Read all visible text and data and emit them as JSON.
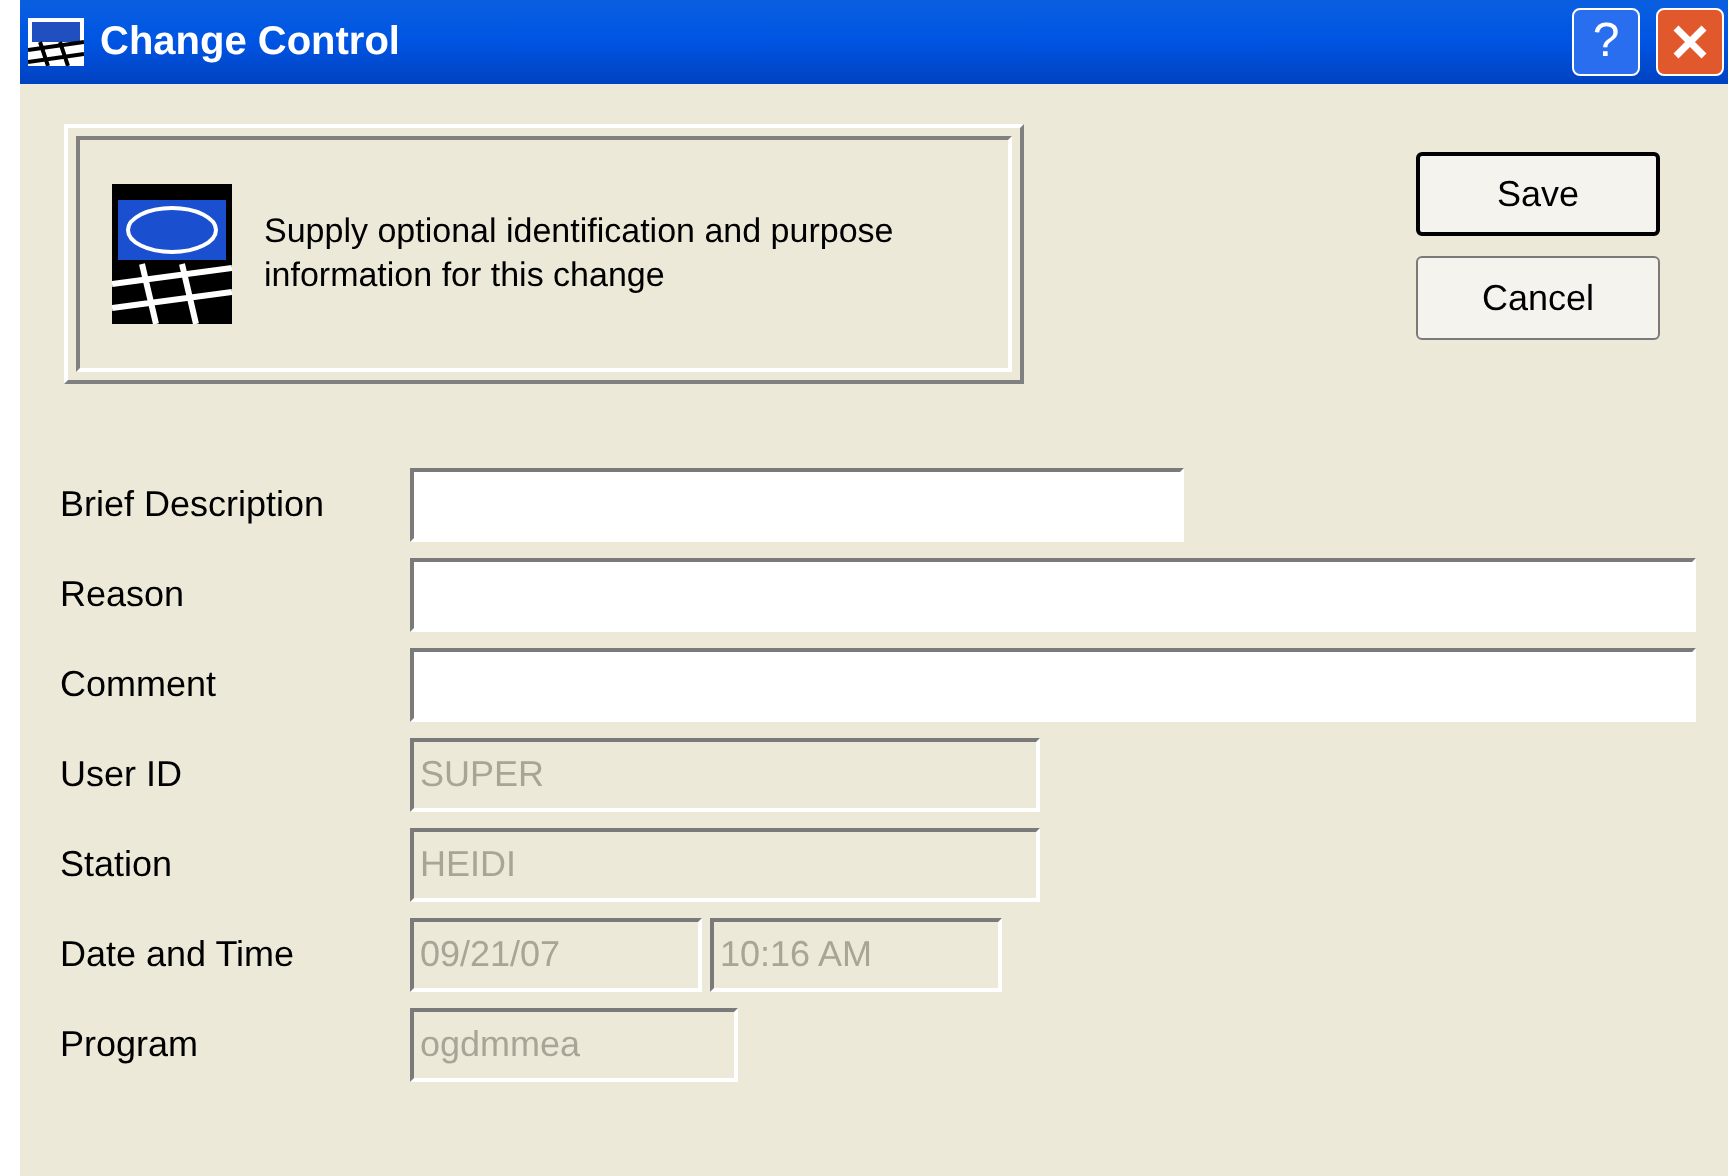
{
  "window": {
    "title": "Change Control",
    "buttons": [
      "?"
    ]
  },
  "info_panel": {
    "text": "Supply optional identification and purpose information for this change"
  },
  "buttons": [
    {
      "label": "Save",
      "default": true
    },
    {
      "label": "Cancel",
      "default": false
    }
  ],
  "fields": [
    {
      "label": "Brief Description",
      "inputs": [
        {
          "disabled": false
        }
      ]
    },
    {
      "label": "Reason",
      "inputs": [
        {
          "disabled": false
        }
      ]
    },
    {
      "label": "Comment",
      "inputs": [
        {
          "disabled": false
        }
      ]
    },
    {
      "label": "User ID",
      "inputs": [
        {
          "value": "SUPER",
          "disabled": true
        }
      ]
    },
    {
      "label": "Station",
      "inputs": [
        {
          "value": "HEIDI",
          "disabled": true
        }
      ]
    },
    {
      "label": "Date and Time",
      "inputs": [
        {
          "value": "09/21/07",
          "disabled": true
        },
        {
          "value": "10:16 AM",
          "disabled": true
        }
      ]
    },
    {
      "label": "Program",
      "inputs": [
        {
          "value": "ogdmmea",
          "disabled": true
        }
      ]
    }
  ]
}
